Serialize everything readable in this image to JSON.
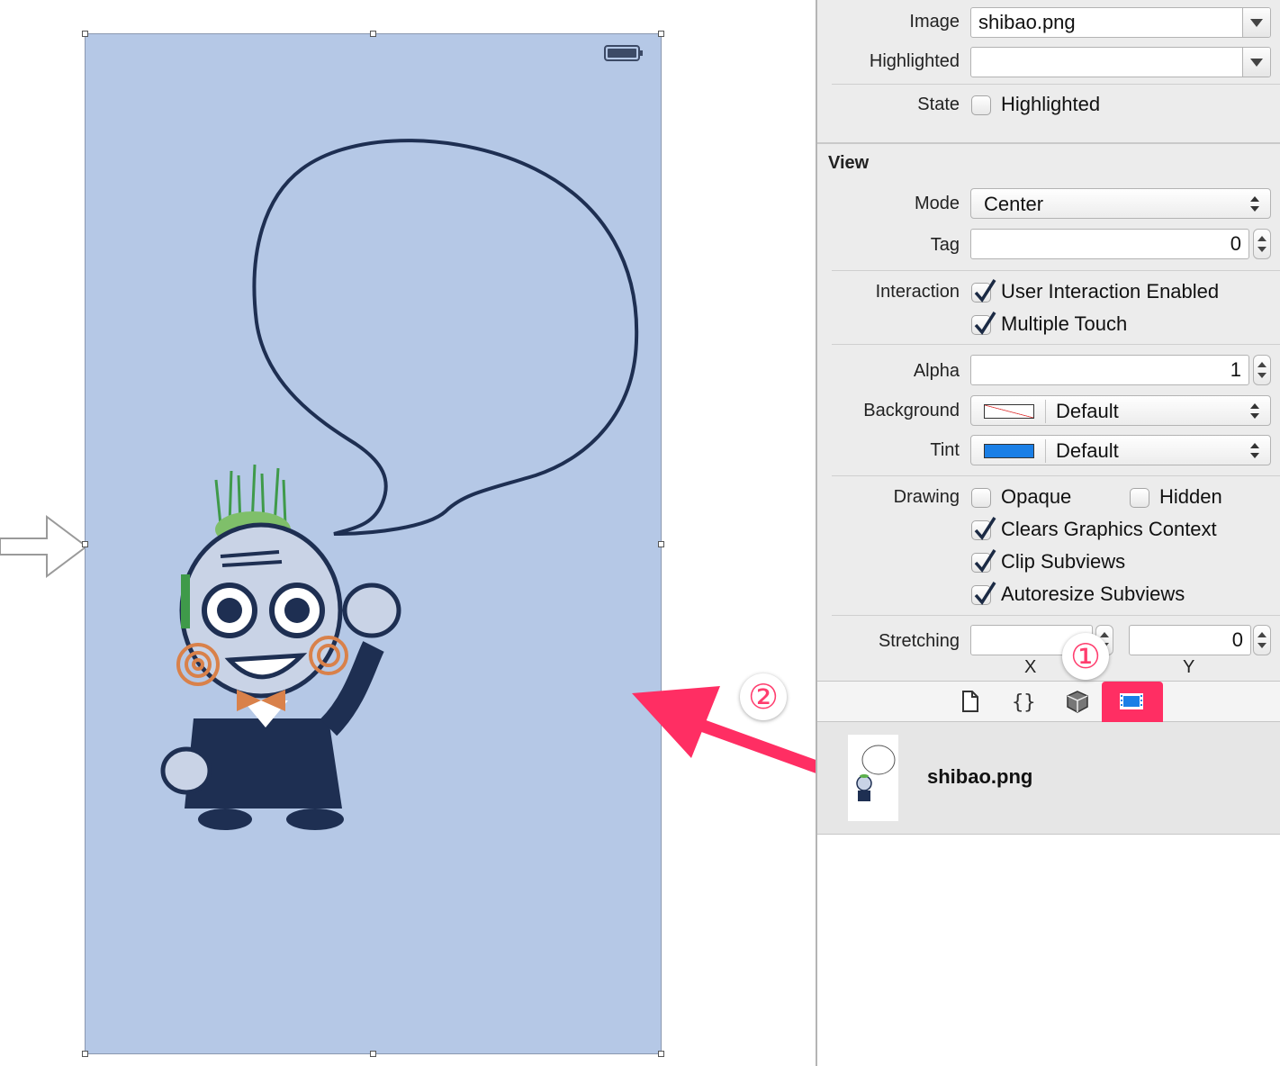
{
  "inspector": {
    "image": {
      "label": "Image",
      "value": "shibao.png"
    },
    "highlighted": {
      "label": "Highlighted",
      "value": ""
    },
    "state": {
      "label": "State",
      "checkbox_label": "Highlighted",
      "checked": false
    },
    "view_section": {
      "title": "View",
      "mode": {
        "label": "Mode",
        "value": "Center"
      },
      "tag": {
        "label": "Tag",
        "value": "0"
      },
      "interaction": {
        "label": "Interaction",
        "user_interaction": {
          "label": "User Interaction Enabled",
          "checked": true
        },
        "multiple_touch": {
          "label": "Multiple Touch",
          "checked": true
        }
      },
      "alpha": {
        "label": "Alpha",
        "value": "1"
      },
      "background": {
        "label": "Background",
        "value": "Default"
      },
      "tint": {
        "label": "Tint",
        "value": "Default",
        "color": "#1a7fe6"
      },
      "drawing": {
        "label": "Drawing",
        "opaque": {
          "label": "Opaque",
          "checked": false
        },
        "hidden": {
          "label": "Hidden",
          "checked": false
        },
        "clears_graphics": {
          "label": "Clears Graphics Context",
          "checked": true
        },
        "clip_subviews": {
          "label": "Clip Subviews",
          "checked": true
        },
        "autoresize": {
          "label": "Autoresize Subviews",
          "checked": true
        }
      },
      "stretching": {
        "label": "Stretching",
        "x_value": "",
        "y_value": "0",
        "x_label": "X",
        "y_label": "Y"
      }
    }
  },
  "library": {
    "tabs": [
      "file-template-icon",
      "code-snippet-icon",
      "object-library-icon",
      "media-library-icon"
    ],
    "selected_tab": "media-library-icon",
    "items": [
      {
        "name": "shibao.png"
      }
    ]
  },
  "annotations": {
    "badge_1": "①",
    "badge_2": "②",
    "highlight_color": "#ff2e63"
  },
  "colors": {
    "canvas_bg": "#b5c8e6",
    "inspector_bg": "#ececec",
    "accent": "#ff2e63"
  }
}
